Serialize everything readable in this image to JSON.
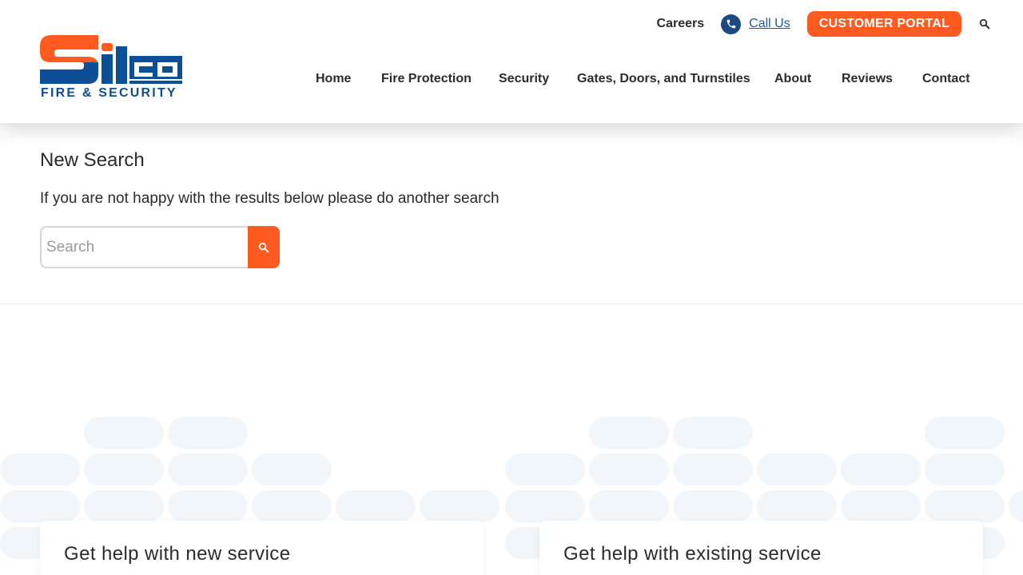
{
  "brand": {
    "logo_name": "Silco",
    "logo_tagline": "FIRE & SECURITY",
    "colors": {
      "orange": "#ff5a1f",
      "blue": "#0d4f96",
      "dark_blue": "#1a4a80"
    }
  },
  "top_bar": {
    "careers": "Careers",
    "call_us": "Call Us",
    "portal": "CUSTOMER PORTAL",
    "icons": [
      "phone-icon",
      "search-icon"
    ]
  },
  "nav": {
    "items": [
      {
        "label": "Home"
      },
      {
        "label": "Fire Protection"
      },
      {
        "label": "Security"
      },
      {
        "label": "Gates, Doors, and Turnstiles"
      },
      {
        "label": "About"
      },
      {
        "label": "Reviews"
      },
      {
        "label": "Contact"
      }
    ]
  },
  "search_section": {
    "title": "New Search",
    "intro": "If you are not happy with the results below please do another search",
    "placeholder": "Search",
    "value": ""
  },
  "cards": [
    {
      "title": "Get help with new service"
    },
    {
      "title": "Get help with existing service"
    }
  ]
}
